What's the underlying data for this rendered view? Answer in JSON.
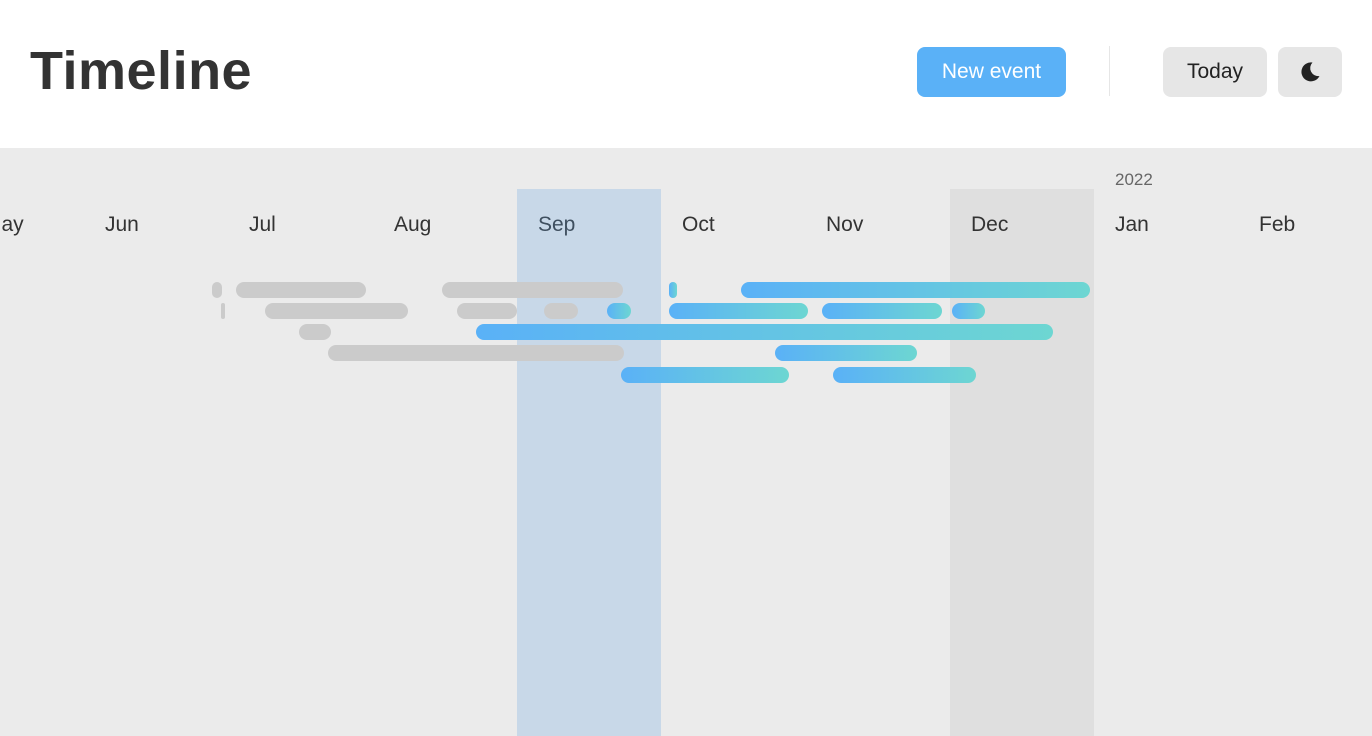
{
  "header": {
    "title": "Timeline",
    "new_event_label": "New event",
    "today_label": "Today",
    "theme_icon": "moon-icon"
  },
  "timeline": {
    "year_label": "2022",
    "months": [
      "May",
      "Jun",
      "Jul",
      "Aug",
      "Sep",
      "Oct",
      "Nov",
      "Dec",
      "Jan",
      "Feb"
    ],
    "current_month": "Sep",
    "highlighted_month": "Dec",
    "colors": {
      "past_event": "#cbcbcb",
      "future_event_start": "#5ab1f7",
      "future_event_end": "#6dd6d2",
      "current_month_band": "#c8d8e8",
      "highlight_band": "#dfdfdf",
      "background": "#ebebeb"
    }
  }
}
